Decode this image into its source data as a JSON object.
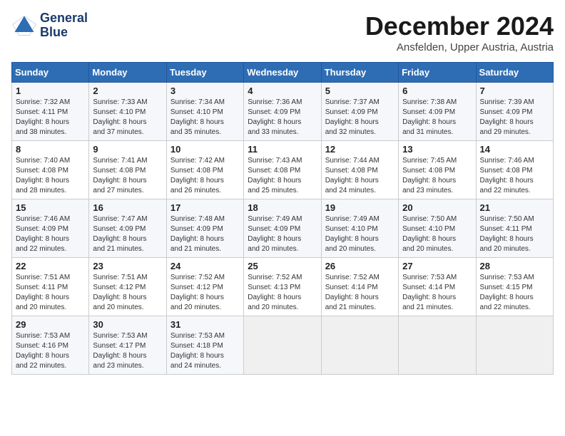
{
  "header": {
    "logo_line1": "General",
    "logo_line2": "Blue",
    "title": "December 2024",
    "subtitle": "Ansfelden, Upper Austria, Austria"
  },
  "weekdays": [
    "Sunday",
    "Monday",
    "Tuesday",
    "Wednesday",
    "Thursday",
    "Friday",
    "Saturday"
  ],
  "weeks": [
    [
      {
        "day": "1",
        "info": "Sunrise: 7:32 AM\nSunset: 4:11 PM\nDaylight: 8 hours\nand 38 minutes."
      },
      {
        "day": "2",
        "info": "Sunrise: 7:33 AM\nSunset: 4:10 PM\nDaylight: 8 hours\nand 37 minutes."
      },
      {
        "day": "3",
        "info": "Sunrise: 7:34 AM\nSunset: 4:10 PM\nDaylight: 8 hours\nand 35 minutes."
      },
      {
        "day": "4",
        "info": "Sunrise: 7:36 AM\nSunset: 4:09 PM\nDaylight: 8 hours\nand 33 minutes."
      },
      {
        "day": "5",
        "info": "Sunrise: 7:37 AM\nSunset: 4:09 PM\nDaylight: 8 hours\nand 32 minutes."
      },
      {
        "day": "6",
        "info": "Sunrise: 7:38 AM\nSunset: 4:09 PM\nDaylight: 8 hours\nand 31 minutes."
      },
      {
        "day": "7",
        "info": "Sunrise: 7:39 AM\nSunset: 4:09 PM\nDaylight: 8 hours\nand 29 minutes."
      }
    ],
    [
      {
        "day": "8",
        "info": "Sunrise: 7:40 AM\nSunset: 4:08 PM\nDaylight: 8 hours\nand 28 minutes."
      },
      {
        "day": "9",
        "info": "Sunrise: 7:41 AM\nSunset: 4:08 PM\nDaylight: 8 hours\nand 27 minutes."
      },
      {
        "day": "10",
        "info": "Sunrise: 7:42 AM\nSunset: 4:08 PM\nDaylight: 8 hours\nand 26 minutes."
      },
      {
        "day": "11",
        "info": "Sunrise: 7:43 AM\nSunset: 4:08 PM\nDaylight: 8 hours\nand 25 minutes."
      },
      {
        "day": "12",
        "info": "Sunrise: 7:44 AM\nSunset: 4:08 PM\nDaylight: 8 hours\nand 24 minutes."
      },
      {
        "day": "13",
        "info": "Sunrise: 7:45 AM\nSunset: 4:08 PM\nDaylight: 8 hours\nand 23 minutes."
      },
      {
        "day": "14",
        "info": "Sunrise: 7:46 AM\nSunset: 4:08 PM\nDaylight: 8 hours\nand 22 minutes."
      }
    ],
    [
      {
        "day": "15",
        "info": "Sunrise: 7:46 AM\nSunset: 4:09 PM\nDaylight: 8 hours\nand 22 minutes."
      },
      {
        "day": "16",
        "info": "Sunrise: 7:47 AM\nSunset: 4:09 PM\nDaylight: 8 hours\nand 21 minutes."
      },
      {
        "day": "17",
        "info": "Sunrise: 7:48 AM\nSunset: 4:09 PM\nDaylight: 8 hours\nand 21 minutes."
      },
      {
        "day": "18",
        "info": "Sunrise: 7:49 AM\nSunset: 4:09 PM\nDaylight: 8 hours\nand 20 minutes."
      },
      {
        "day": "19",
        "info": "Sunrise: 7:49 AM\nSunset: 4:10 PM\nDaylight: 8 hours\nand 20 minutes."
      },
      {
        "day": "20",
        "info": "Sunrise: 7:50 AM\nSunset: 4:10 PM\nDaylight: 8 hours\nand 20 minutes."
      },
      {
        "day": "21",
        "info": "Sunrise: 7:50 AM\nSunset: 4:11 PM\nDaylight: 8 hours\nand 20 minutes."
      }
    ],
    [
      {
        "day": "22",
        "info": "Sunrise: 7:51 AM\nSunset: 4:11 PM\nDaylight: 8 hours\nand 20 minutes."
      },
      {
        "day": "23",
        "info": "Sunrise: 7:51 AM\nSunset: 4:12 PM\nDaylight: 8 hours\nand 20 minutes."
      },
      {
        "day": "24",
        "info": "Sunrise: 7:52 AM\nSunset: 4:12 PM\nDaylight: 8 hours\nand 20 minutes."
      },
      {
        "day": "25",
        "info": "Sunrise: 7:52 AM\nSunset: 4:13 PM\nDaylight: 8 hours\nand 20 minutes."
      },
      {
        "day": "26",
        "info": "Sunrise: 7:52 AM\nSunset: 4:14 PM\nDaylight: 8 hours\nand 21 minutes."
      },
      {
        "day": "27",
        "info": "Sunrise: 7:53 AM\nSunset: 4:14 PM\nDaylight: 8 hours\nand 21 minutes."
      },
      {
        "day": "28",
        "info": "Sunrise: 7:53 AM\nSunset: 4:15 PM\nDaylight: 8 hours\nand 22 minutes."
      }
    ],
    [
      {
        "day": "29",
        "info": "Sunrise: 7:53 AM\nSunset: 4:16 PM\nDaylight: 8 hours\nand 22 minutes."
      },
      {
        "day": "30",
        "info": "Sunrise: 7:53 AM\nSunset: 4:17 PM\nDaylight: 8 hours\nand 23 minutes."
      },
      {
        "day": "31",
        "info": "Sunrise: 7:53 AM\nSunset: 4:18 PM\nDaylight: 8 hours\nand 24 minutes."
      },
      null,
      null,
      null,
      null
    ]
  ]
}
